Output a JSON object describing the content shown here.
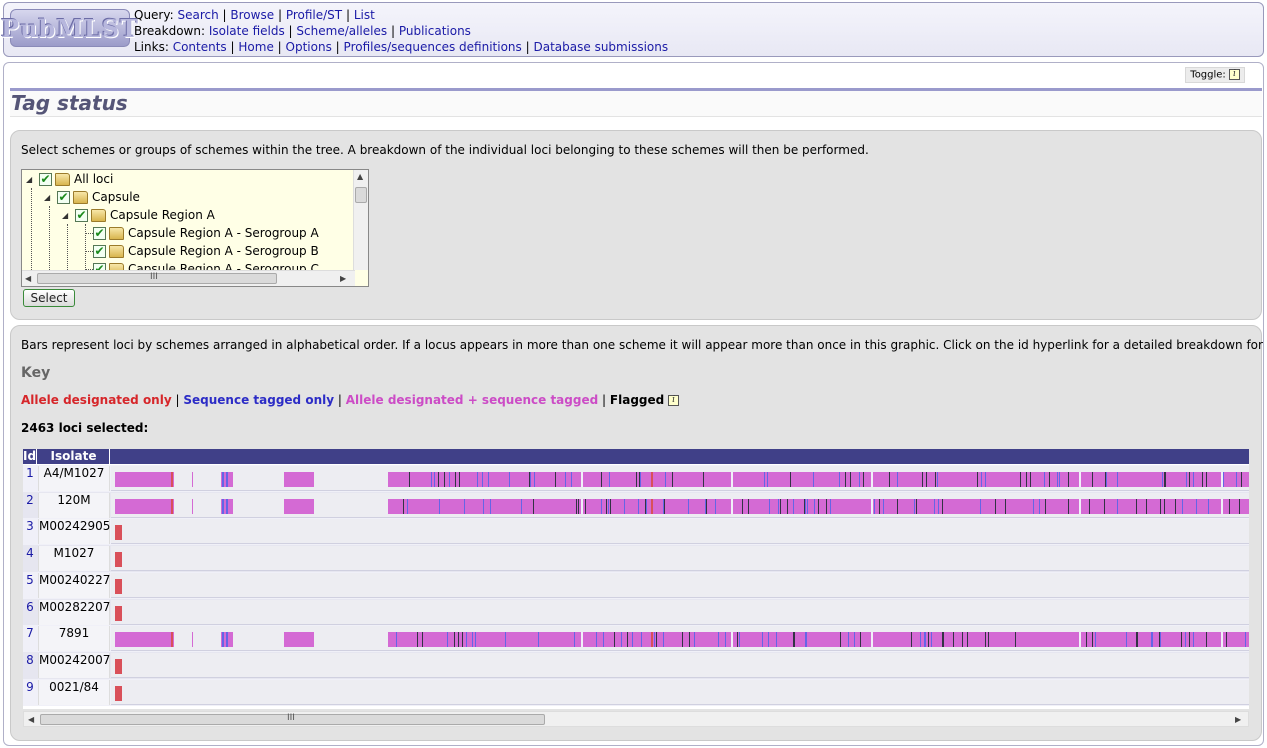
{
  "header": {
    "logo_text": "PubMLST",
    "query_label": "Query:",
    "query_links": [
      "Search",
      "Browse",
      "Profile/ST",
      "List"
    ],
    "breakdown_label": "Breakdown:",
    "breakdown_links": [
      "Isolate fields",
      "Scheme/alleles",
      "Publications"
    ],
    "links_label": "Links:",
    "links_links": [
      "Contents",
      "Home",
      "Options",
      "Profiles/sequences definitions",
      "Database submissions"
    ]
  },
  "toggle_label": "Toggle:",
  "info_icon_glyph": "i",
  "page_title": "Tag status",
  "scheme_box": {
    "instruction": "Select schemes or groups of schemes within the tree. A breakdown of the individual loci belonging to these schemes will then be performed.",
    "tree": [
      {
        "label": "All loci",
        "checked": true,
        "expanded": true
      },
      {
        "label": "Capsule",
        "checked": true,
        "expanded": true
      },
      {
        "label": "Capsule Region A",
        "checked": true,
        "expanded": true
      },
      {
        "label": "Capsule Region A - Serogroup A",
        "checked": true
      },
      {
        "label": "Capsule Region A - Serogroup B",
        "checked": true
      },
      {
        "label": "Capsule Region A - Serogroup C",
        "checked": true
      }
    ],
    "scroll_thumb_glyph": "III",
    "select_button": "Select"
  },
  "results_box": {
    "description": "Bars represent loci by schemes arranged in alphabetical order. If a locus appears in more than one scheme it will appear more than once in this graphic. Click on the id hyperlink for a detailed breakdown for an isolate.",
    "key_heading": "Key",
    "key": {
      "allele_only": "Allele designated only",
      "sequence_only": "Sequence tagged only",
      "both": "Allele designated + sequence tagged",
      "flagged": "Flagged",
      "separator": "|"
    },
    "key_colors": {
      "allele_only": "#d9505a",
      "sequence_only": "#6565e6",
      "both": "#d46ad4",
      "flagged": "#333344"
    },
    "loci_selected": "2463 loci selected:",
    "table_headers": {
      "id": "Id",
      "isolate": "Isolate"
    },
    "rows": [
      {
        "id": "1",
        "isolate": "A4/M1027",
        "pattern": "full"
      },
      {
        "id": "2",
        "isolate": "120M",
        "pattern": "full"
      },
      {
        "id": "3",
        "isolate": "M00242905",
        "pattern": "short"
      },
      {
        "id": "4",
        "isolate": "M1027",
        "pattern": "short"
      },
      {
        "id": "5",
        "isolate": "M00240227",
        "pattern": "short"
      },
      {
        "id": "6",
        "isolate": "M00282207",
        "pattern": "short"
      },
      {
        "id": "7",
        "isolate": "7891",
        "pattern": "full"
      },
      {
        "id": "8",
        "isolate": "M00242007",
        "pattern": "short"
      },
      {
        "id": "9",
        "isolate": "0021/84",
        "pattern": "short"
      }
    ],
    "scroll_thumb_glyph": "III"
  }
}
